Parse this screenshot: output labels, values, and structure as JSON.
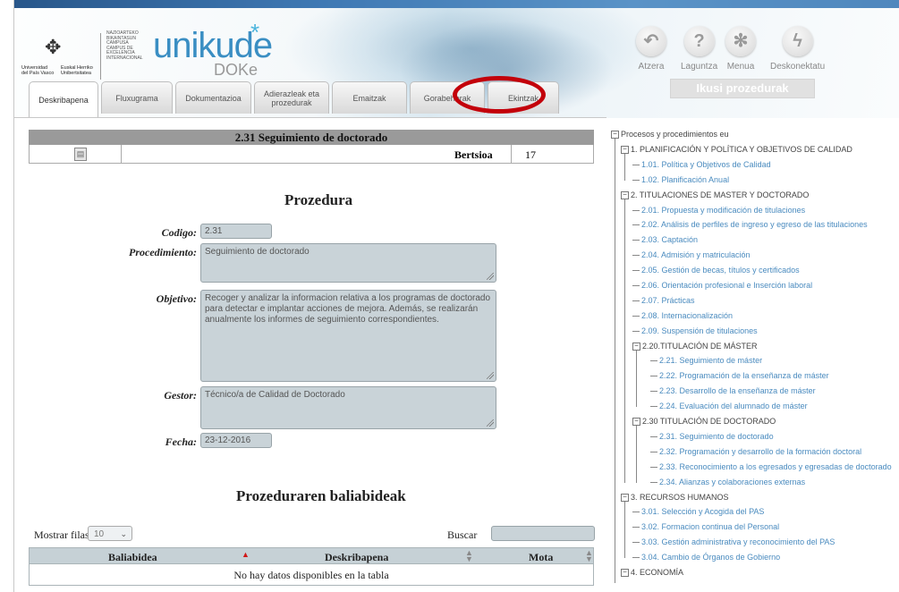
{
  "header": {
    "university_lines": [
      "Universidad",
      "del País Vasco"
    ],
    "university_lines2": [
      "Euskal Herriko",
      "Unibertsitatea"
    ],
    "campus_lines": [
      "NAZIOARTEKO",
      "BIKAINTASUN",
      "CAMPUSA",
      "CAMPUS DE",
      "EXCELENCIA",
      "INTERNACIONAL"
    ],
    "app_name": "unikude",
    "app_star": "*",
    "app_sub": "DOKe",
    "toolbar": [
      {
        "label": "Atzera",
        "icon": "back-arrow-icon",
        "glyph": "↶"
      },
      {
        "label": "Laguntza",
        "icon": "help-icon",
        "glyph": "?"
      },
      {
        "label": "Menua",
        "icon": "menu-star-icon",
        "glyph": "✻"
      },
      {
        "label": "Deskonektatu",
        "icon": "disconnect-icon",
        "glyph": "ϟ"
      }
    ],
    "ikusi_button": "Ikusi prozedurak"
  },
  "tabs": [
    {
      "label": "Deskribapena",
      "active": true
    },
    {
      "label": "Fluxugrama",
      "active": false
    },
    {
      "label": "Dokumentazioa",
      "active": false
    },
    {
      "label": "Adierazleak eta prozedurak",
      "active": false
    },
    {
      "label": "Emaitzak",
      "active": false
    },
    {
      "label": "Gorabeherak",
      "active": false
    },
    {
      "label": "Ekintzak",
      "active": false
    }
  ],
  "procedure": {
    "title": "2.31 Seguimiento de doctorado",
    "version_label": "Bertsioa",
    "version_value": "17",
    "heading": "Prozedura",
    "fields": {
      "codigo_label": "Codigo:",
      "codigo_value": "2.31",
      "procedimiento_label": "Procedimiento:",
      "procedimiento_value": "Seguimiento de doctorado",
      "objetivo_label": "Objetivo:",
      "objetivo_value": "Recoger y analizar la informacion relativa a los programas de doctorado para detectar e implantar acciones de mejora. Además, se realizarán anualmente los informes de seguimiento correspondientes.",
      "gestor_label": "Gestor:",
      "gestor_value": "Técnico/a de Calidad de Doctorado",
      "fecha_label": "Fecha:",
      "fecha_value": "23-12-2016"
    }
  },
  "resources": {
    "heading": "Prozeduraren baliabideak",
    "show_rows_label": "Mostrar filas",
    "show_rows_value": "10",
    "search_label": "Buscar",
    "columns": [
      "Baliabidea",
      "Deskribapena",
      "Mota"
    ],
    "empty_text": "No hay datos disponibles en la tabla"
  },
  "tree": {
    "root": "Procesos y procedimientos eu",
    "items": [
      {
        "text": "1. PLANIFICACIÓN Y POLÍTICA Y OBJETIVOS DE CALIDAD",
        "level": 1,
        "kind": "grp"
      },
      {
        "text": "1.01. Política y Objetivos de Calidad",
        "level": 2,
        "kind": "leaf"
      },
      {
        "text": "1.02. Planificación Anual",
        "level": 2,
        "kind": "leaf"
      },
      {
        "text": "2. TITULACIONES DE MASTER Y DOCTORADO",
        "level": 1,
        "kind": "grp"
      },
      {
        "text": "2.01. Propuesta y modificación de titulaciones",
        "level": 2,
        "kind": "leaf"
      },
      {
        "text": "2.02. Análisis de perfiles de ingreso y egreso de las titulaciones",
        "level": 2,
        "kind": "leaf"
      },
      {
        "text": "2.03. Captación",
        "level": 2,
        "kind": "leaf"
      },
      {
        "text": "2.04. Admisión y matriculación",
        "level": 2,
        "kind": "leaf"
      },
      {
        "text": "2.05. Gestión de becas, títulos y certificados",
        "level": 2,
        "kind": "leaf"
      },
      {
        "text": "2.06. Orientación profesional e Inserción laboral",
        "level": 2,
        "kind": "leaf"
      },
      {
        "text": "2.07. Prácticas",
        "level": 2,
        "kind": "leaf"
      },
      {
        "text": "2.08. Internacionalización",
        "level": 2,
        "kind": "leaf"
      },
      {
        "text": "2.09. Suspensión de titulaciones",
        "level": 2,
        "kind": "leaf"
      },
      {
        "text": "2.20.TITULACIÓN DE MÁSTER",
        "level": 2,
        "kind": "sub"
      },
      {
        "text": "2.21. Seguimiento de máster",
        "level": 3,
        "kind": "leaf"
      },
      {
        "text": "2.22. Programación de la enseñanza de máster",
        "level": 3,
        "kind": "leaf"
      },
      {
        "text": "2.23. Desarrollo de la enseñanza de máster",
        "level": 3,
        "kind": "leaf"
      },
      {
        "text": "2.24. Evaluación del alumnado de máster",
        "level": 3,
        "kind": "leaf"
      },
      {
        "text": "2.30 TITULACIÓN DE DOCTORADO",
        "level": 2,
        "kind": "sub"
      },
      {
        "text": "2.31. Seguimiento de doctorado",
        "level": 3,
        "kind": "leaf"
      },
      {
        "text": "2.32. Programación y desarrollo de la formación doctoral",
        "level": 3,
        "kind": "leaf"
      },
      {
        "text": "2.33. Reconocimiento a los egresados y egresadas de doctorado",
        "level": 3,
        "kind": "leaf"
      },
      {
        "text": "2.34. Alianzas y colaboraciones externas",
        "level": 3,
        "kind": "leaf"
      },
      {
        "text": "3. RECURSOS HUMANOS",
        "level": 1,
        "kind": "grp"
      },
      {
        "text": "3.01. Selección y Acogida del PAS",
        "level": 2,
        "kind": "leaf"
      },
      {
        "text": "3.02. Formacion continua del Personal",
        "level": 2,
        "kind": "leaf"
      },
      {
        "text": "3.03. Gestión administrativa y reconocimiento del PAS",
        "level": 2,
        "kind": "leaf"
      },
      {
        "text": "3.04. Cambio de Órganos de Gobierno",
        "level": 2,
        "kind": "leaf"
      },
      {
        "text": "4. ECONOMÍA",
        "level": 1,
        "kind": "grp"
      }
    ]
  },
  "colors": {
    "accent_blue": "#3a8ec3",
    "tree_link": "#4a8bbf",
    "field_bg": "#c9d3d8",
    "highlight_circle": "#c3000a"
  }
}
